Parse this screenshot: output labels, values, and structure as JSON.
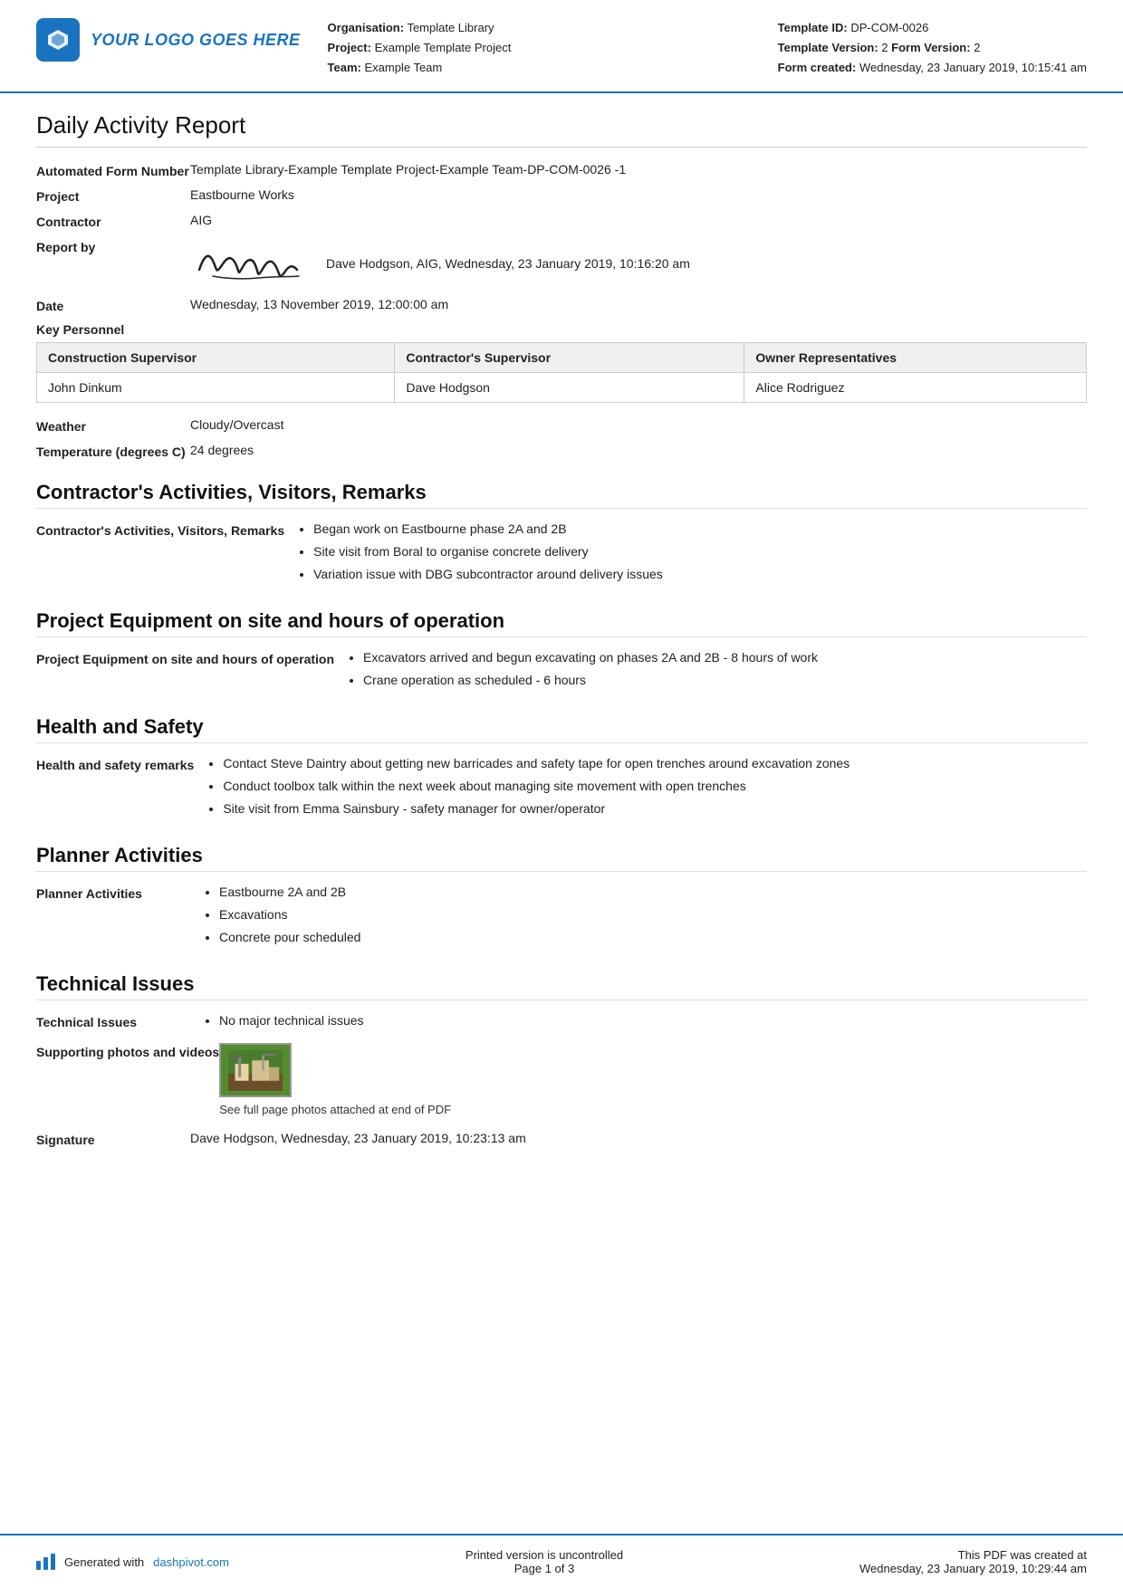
{
  "header": {
    "logo_text": "YOUR LOGO GOES HERE",
    "org_label": "Organisation:",
    "org_value": "Template Library",
    "project_label": "Project:",
    "project_value": "Example Template Project",
    "team_label": "Team:",
    "team_value": "Example Team",
    "template_id_label": "Template ID:",
    "template_id_value": "DP-COM-0026",
    "template_version_label": "Template Version:",
    "template_version_value": "2",
    "form_version_label": "Form Version:",
    "form_version_value": "2",
    "form_created_label": "Form created:",
    "form_created_value": "Wednesday, 23 January 2019, 10:15:41 am"
  },
  "report": {
    "title": "Daily Activity Report",
    "automated_form_label": "Automated Form Number",
    "automated_form_value": "Template Library-Example Template Project-Example Team-DP-COM-0026   -1",
    "project_label": "Project",
    "project_value": "Eastbourne Works",
    "contractor_label": "Contractor",
    "contractor_value": "AIG",
    "report_by_label": "Report by",
    "report_by_value": "Dave Hodgson, AIG, Wednesday, 23 January 2019, 10:16:20 am",
    "date_label": "Date",
    "date_value": "Wednesday, 13 November 2019, 12:00:00 am",
    "key_personnel_label": "Key Personnel",
    "personnel_columns": [
      "Construction Supervisor",
      "Contractor's Supervisor",
      "Owner Representatives"
    ],
    "personnel_row": [
      "John Dinkum",
      "Dave Hodgson",
      "Alice Rodriguez"
    ],
    "weather_label": "Weather",
    "weather_value": "Cloudy/Overcast",
    "temperature_label": "Temperature (degrees C)",
    "temperature_value": "24 degrees"
  },
  "sections": {
    "contractors_activities": {
      "heading": "Contractor's Activities, Visitors, Remarks",
      "label": "Contractor's Activities, Visitors, Remarks",
      "items": [
        "Began work on Eastbourne phase 2A and 2B",
        "Site visit from Boral to organise concrete delivery",
        "Variation issue with DBG subcontractor around delivery issues"
      ]
    },
    "project_equipment": {
      "heading": "Project Equipment on site and hours of operation",
      "label": "Project Equipment on site and hours of operation",
      "items": [
        "Excavators arrived and begun excavating on phases 2A and 2B - 8 hours of work",
        "Crane operation as scheduled - 6 hours"
      ]
    },
    "health_safety": {
      "heading": "Health and Safety",
      "label": "Health and safety remarks",
      "items": [
        "Contact Steve Daintry about getting new barricades and safety tape for open trenches around excavation zones",
        "Conduct toolbox talk within the next week about managing site movement with open trenches",
        "Site visit from Emma Sainsbury - safety manager for owner/operator"
      ]
    },
    "planner_activities": {
      "heading": "Planner Activities",
      "label": "Planner Activities",
      "items": [
        "Eastbourne 2A and 2B",
        "Excavations",
        "Concrete pour scheduled"
      ]
    },
    "technical_issues": {
      "heading": "Technical Issues",
      "label": "Technical Issues",
      "items": [
        "No major technical issues"
      ],
      "supporting_label": "Supporting photos and videos",
      "photo_caption": "See full page photos attached at end of PDF"
    },
    "signature": {
      "label": "Signature",
      "value": "Dave Hodgson, Wednesday, 23 January 2019, 10:23:13 am"
    }
  },
  "footer": {
    "generated_text": "Generated with ",
    "link_text": "dashpivot.com",
    "center_line1": "Printed version is uncontrolled",
    "center_line2": "Page 1 of 3",
    "right_line1": "This PDF was created at",
    "right_line2": "Wednesday, 23 January 2019, 10:29:44 am"
  }
}
